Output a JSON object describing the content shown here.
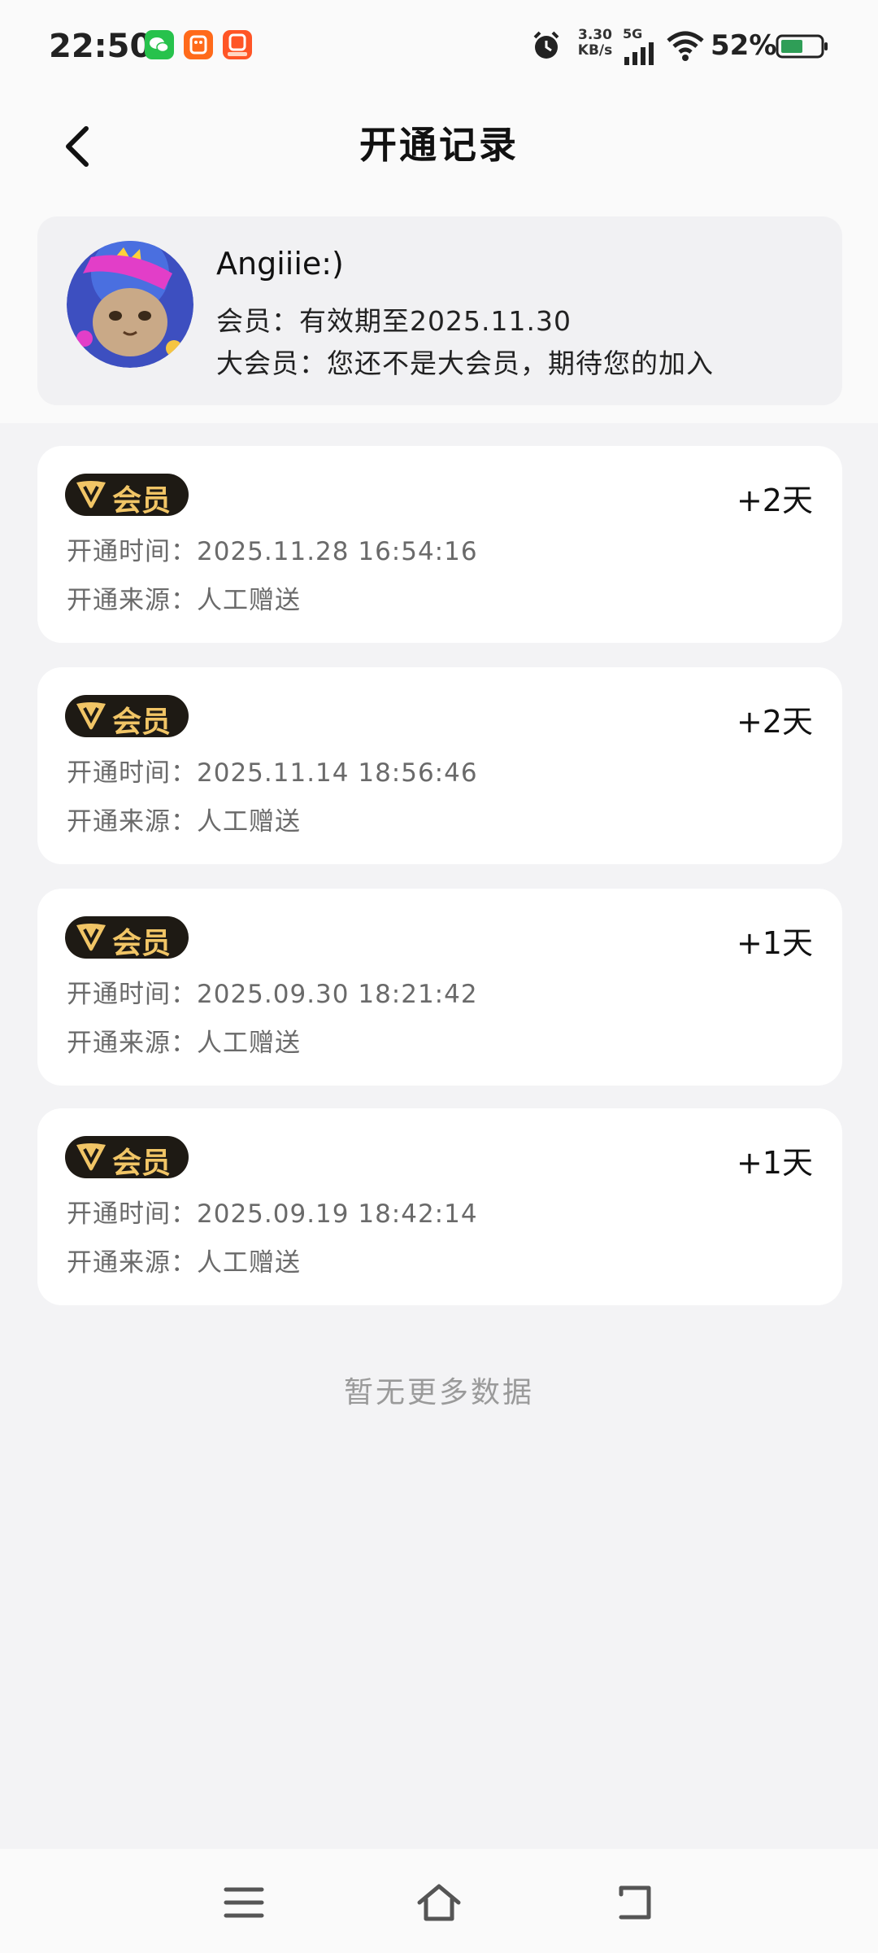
{
  "status_bar": {
    "time": "22:50",
    "net_speed_value": "3.30",
    "net_speed_unit": "KB/s",
    "network_type": "5G",
    "battery_percent": "52%"
  },
  "header": {
    "title": "开通记录"
  },
  "profile": {
    "name": "Angiiie:)",
    "member_line": "会员：有效期至2025.11.30",
    "big_member_line": "大会员：您还不是大会员，期待您的加入"
  },
  "badge_label": "会员",
  "records": [
    {
      "days": "+2天",
      "time_line": "开通时间：2025.11.28 16:54:16",
      "source_line": "开通来源：人工赠送"
    },
    {
      "days": "+2天",
      "time_line": "开通时间：2025.11.14 18:56:46",
      "source_line": "开通来源：人工赠送"
    },
    {
      "days": "+1天",
      "time_line": "开通时间：2025.09.30 18:21:42",
      "source_line": "开通来源：人工赠送"
    },
    {
      "days": "+1天",
      "time_line": "开通时间：2025.09.19 18:42:14",
      "source_line": "开通来源：人工赠送"
    }
  ],
  "footer_text": "暂无更多数据",
  "colors": {
    "badge_bg": "#1e1a14",
    "badge_gold": "#f1c566",
    "page_bg": "#f3f3f5",
    "card_bg": "#ffffff"
  }
}
